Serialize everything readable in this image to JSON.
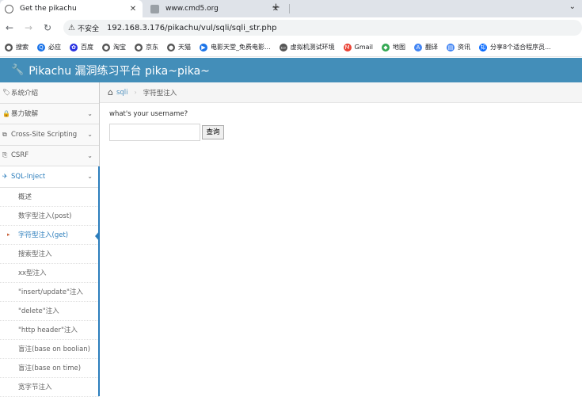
{
  "browser": {
    "tabs": [
      {
        "title": "Get the pikachu",
        "active": true
      },
      {
        "title": "www.cmd5.org",
        "active": false
      }
    ],
    "new_tab": "+",
    "address": {
      "security_label": "不安全",
      "url": "192.168.3.176/pikachu/vul/sqli/sqli_str.php"
    },
    "bookmarks": [
      {
        "label": "搜索",
        "icon": "globe-icon",
        "color": "#555555"
      },
      {
        "label": "必应",
        "icon": "search-icon",
        "color": "#1a73e8"
      },
      {
        "label": "百度",
        "icon": "paw-icon",
        "color": "#2932e1"
      },
      {
        "label": "淘宝",
        "icon": "globe-icon",
        "color": "#555555"
      },
      {
        "label": "京东",
        "icon": "globe-icon",
        "color": "#555555"
      },
      {
        "label": "天猫",
        "icon": "globe-icon",
        "color": "#555555"
      },
      {
        "label": "电影天堂_免费电影...",
        "icon": "play-icon",
        "color": "#1a73e8"
      },
      {
        "label": "虚拟机测试环境",
        "icon": "folder-icon",
        "color": "#555555"
      },
      {
        "label": "Gmail",
        "icon": "gmail-icon",
        "color": "#ea4335"
      },
      {
        "label": "地图",
        "icon": "map-icon",
        "color": "#34a853"
      },
      {
        "label": "翻译",
        "icon": "translate-icon",
        "color": "#4285f4"
      },
      {
        "label": "资讯",
        "icon": "news-icon",
        "color": "#4285f4"
      },
      {
        "label": "分享8个适合程序员...",
        "icon": "zhihu-icon",
        "color": "#0066ff"
      }
    ]
  },
  "header": {
    "title": "Pikachu 漏洞练习平台 pika~pika~",
    "color": "#438eb9"
  },
  "sidebar": {
    "items": [
      {
        "label": "系统介绍",
        "icon": "tags-icon",
        "has_chevron": false
      },
      {
        "label": "暴力破解",
        "icon": "lock-icon",
        "has_chevron": true
      },
      {
        "label": "Cross-Site Scripting",
        "icon": "sitemap-icon",
        "has_chevron": true
      },
      {
        "label": "CSRF",
        "icon": "share-icon",
        "has_chevron": true
      },
      {
        "label": "SQL-Inject",
        "icon": "fighter-jet-icon",
        "has_chevron": true,
        "open": true
      }
    ],
    "subitems": [
      {
        "label": "概述",
        "active": false
      },
      {
        "label": "数字型注入(post)",
        "active": false
      },
      {
        "label": "字符型注入(get)",
        "active": true
      },
      {
        "label": "搜索型注入",
        "active": false
      },
      {
        "label": "xx型注入",
        "active": false
      },
      {
        "label": "\"insert/update\"注入",
        "active": false
      },
      {
        "label": "\"delete\"注入",
        "active": false
      },
      {
        "label": "\"http header\"注入",
        "active": false
      },
      {
        "label": "盲注(base on boolian)",
        "active": false
      },
      {
        "label": "盲注(base on time)",
        "active": false
      },
      {
        "label": "宽字节注入",
        "active": false
      }
    ]
  },
  "breadcrumb": {
    "link": "sqli",
    "current": "字符型注入"
  },
  "main": {
    "question": "what's your username?",
    "input_value": "",
    "submit_label": "查询"
  }
}
